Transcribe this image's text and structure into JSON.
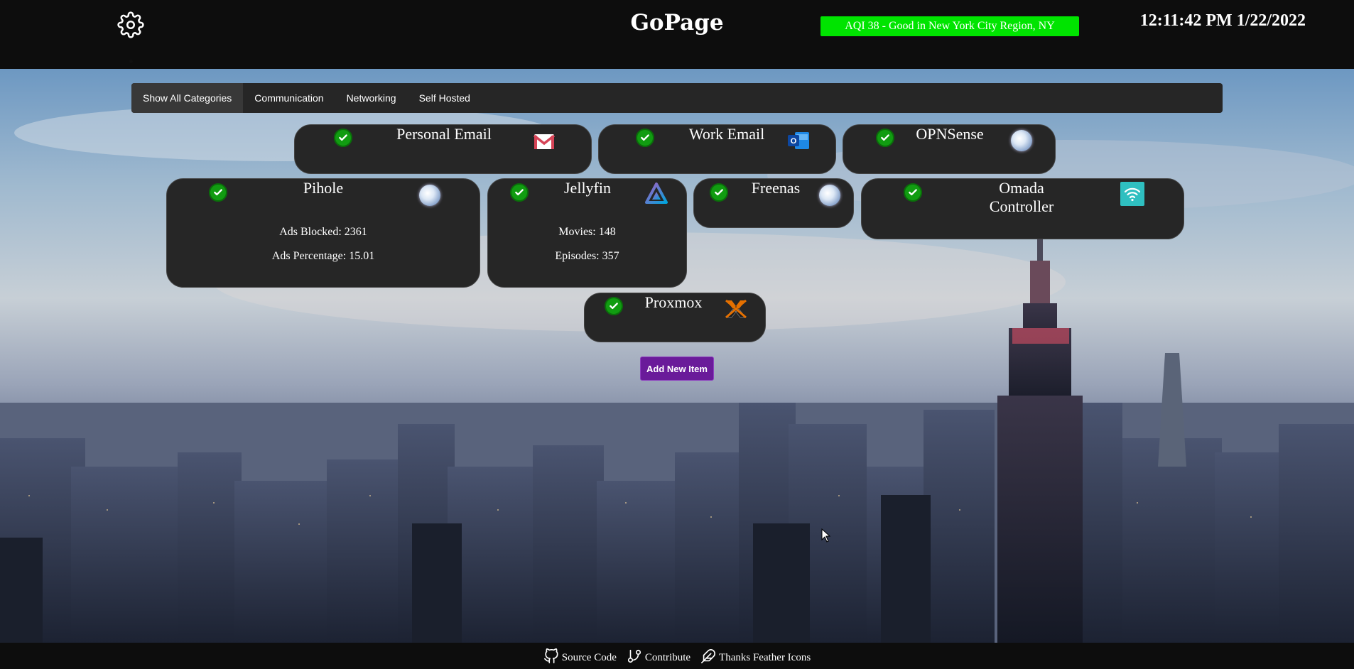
{
  "header": {
    "title": "GoPage",
    "aqi_text": "AQI 38 - Good in New York City Region, NY",
    "aqi_color": "#00e400",
    "clock": "12:11:42 PM 1/22/2022",
    "settings_icon": "gear-icon"
  },
  "tabs": [
    {
      "label": "Show All Categories",
      "active": true
    },
    {
      "label": "Communication",
      "active": false
    },
    {
      "label": "Networking",
      "active": false
    },
    {
      "label": "Self Hosted",
      "active": false
    }
  ],
  "cards": {
    "personal_email": {
      "title": "Personal Email",
      "status": "up",
      "icon": "gmail-icon"
    },
    "work_email": {
      "title": "Work Email",
      "status": "up",
      "icon": "outlook-icon"
    },
    "opnsense": {
      "title": "OPNSense",
      "status": "up",
      "icon": "globe-icon"
    },
    "pihole": {
      "title": "Pihole",
      "status": "up",
      "icon": "globe-icon",
      "stat1": "Ads Blocked: 2361",
      "stat2": "Ads Percentage: 15.01"
    },
    "jellyfin": {
      "title": "Jellyfin",
      "status": "up",
      "icon": "jellyfin-icon",
      "stat1": "Movies: 148",
      "stat2": "Episodes: 357"
    },
    "freenas": {
      "title": "Freenas",
      "status": "up",
      "icon": "globe-icon"
    },
    "omada": {
      "title_line1": "Omada",
      "title_line2": "Controller",
      "status": "up",
      "icon": "wifi-icon"
    },
    "proxmox": {
      "title": "Proxmox",
      "status": "up",
      "icon": "proxmox-icon"
    }
  },
  "add_button": {
    "label": "Add New Item",
    "color": "#6a1b9a"
  },
  "footer": {
    "source_code": "Source Code",
    "contribute": "Contribute",
    "thanks": "Thanks Feather Icons"
  }
}
